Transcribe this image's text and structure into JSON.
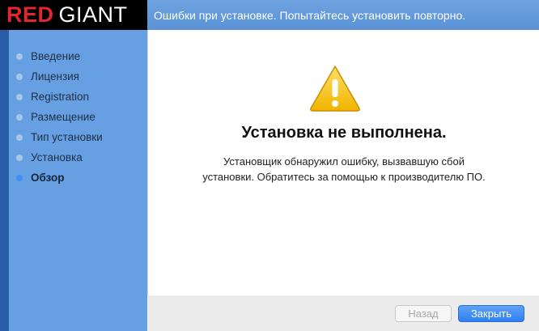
{
  "logo": {
    "red": "RED",
    "white": "GIANT"
  },
  "header": {
    "text": "Ошибки при установке. Попытайтесь установить повторно."
  },
  "sidebar": {
    "items": [
      {
        "label": "Введение",
        "active": false
      },
      {
        "label": "Лицензия",
        "active": false
      },
      {
        "label": "Registration",
        "active": false
      },
      {
        "label": "Размещение",
        "active": false
      },
      {
        "label": "Тип установки",
        "active": false
      },
      {
        "label": "Установка",
        "active": false
      },
      {
        "label": "Обзор",
        "active": true
      }
    ]
  },
  "main": {
    "icon": "warning-icon",
    "title": "Установка не выполнена.",
    "message_line1": "Установщик обнаружил ошибку, вызвавшую сбой",
    "message_line2": "установки. Обратитесь за помощью к производителю ПО."
  },
  "buttons": {
    "back_label": "Назад",
    "close_label": "Закрыть"
  },
  "colors": {
    "accent": "#2f7ff2",
    "sidebar": "#67a0e2",
    "brand_red": "#e0262f"
  }
}
